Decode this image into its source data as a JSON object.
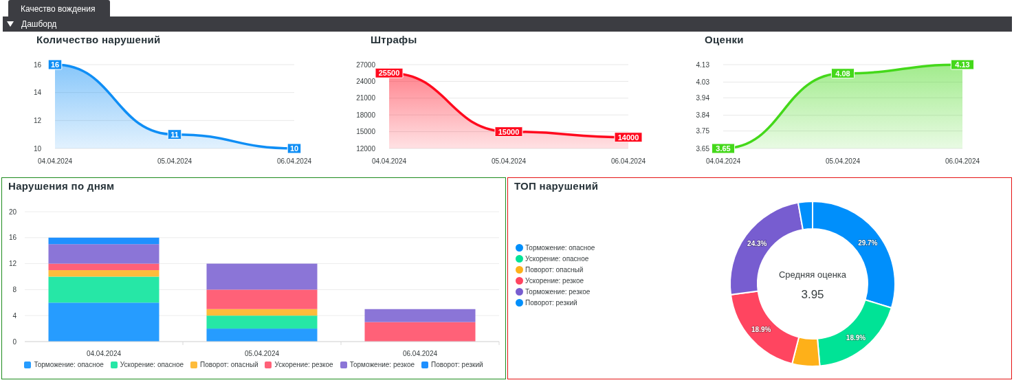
{
  "tabs": [
    {
      "label": "Качество вождения",
      "selected": true
    }
  ],
  "section": {
    "label": "Дашборд",
    "expanded": true
  },
  "line_charts": [
    {
      "title": "Количество нарушений",
      "chart_data": {
        "type": "area",
        "categories": [
          "04.04.2024",
          "05.04.2024",
          "06.04.2024"
        ],
        "ylim": [
          10,
          16
        ],
        "grid": true,
        "yticks": [
          10,
          12,
          14,
          16
        ],
        "data_labels": true,
        "series": [
          {
            "color": "#0f8ef5",
            "values": [
              16,
              11,
              10
            ]
          }
        ]
      }
    },
    {
      "title": "Штрафы",
      "chart_data": {
        "type": "area",
        "categories": [
          "04.04.2024",
          "05.04.2024",
          "06.04.2024"
        ],
        "ylim": [
          12000,
          27000
        ],
        "grid": true,
        "yticks": [
          12000,
          15000,
          18000,
          21000,
          24000,
          27000
        ],
        "data_labels": true,
        "series": [
          {
            "color": "#ff0a1e",
            "values": [
              25500,
              15000,
              14000
            ]
          }
        ]
      }
    },
    {
      "title": "Оценки",
      "chart_data": {
        "type": "area",
        "categories": [
          "04.04.2024",
          "05.04.2024",
          "06.04.2024"
        ],
        "ylim": [
          3.65,
          4.13
        ],
        "grid": true,
        "yticks": [
          3.65,
          3.75,
          3.84,
          3.94,
          4.03,
          4.13
        ],
        "data_labels": true,
        "series": [
          {
            "color": "#44d81a",
            "values": [
              3.65,
              4.08,
              4.13
            ]
          }
        ]
      }
    }
  ],
  "violations_by_day": {
    "title": "Нарушения по дням",
    "chart_data": {
      "type": "bar",
      "stacked": true,
      "categories": [
        "04.04.2024",
        "05.04.2024",
        "06.04.2024"
      ],
      "ylim": [
        0,
        20
      ],
      "grid": true,
      "yticks": [
        0,
        4,
        8,
        12,
        16,
        20
      ],
      "series": [
        {
          "name": "Торможение: опасное",
          "color": "#269cff",
          "values": [
            6,
            2,
            0
          ]
        },
        {
          "name": "Ускорение: опасное",
          "color": "#26e7a6",
          "values": [
            4,
            2,
            0
          ]
        },
        {
          "name": "Поворот: опасный",
          "color": "#febc3b",
          "values": [
            1,
            1,
            0
          ]
        },
        {
          "name": "Ускорение: резкое",
          "color": "#ff6178",
          "values": [
            1,
            3,
            3
          ]
        },
        {
          "name": "Торможение: резкое",
          "color": "#8b75d7",
          "values": [
            3,
            4,
            2
          ]
        },
        {
          "name": "Поворот: резкий",
          "color": "#1e90ff",
          "values": [
            1,
            0,
            0
          ]
        }
      ]
    }
  },
  "top_violations": {
    "title": "ТОП нарушений",
    "center_label": "Средняя оценка",
    "center_value": "3.95",
    "chart_data": {
      "type": "donut",
      "categories": [
        "Торможение: опасное",
        "Ускорение: опасное",
        "Поворот: опасный",
        "Ускорение: резкое",
        "Торможение: резкое",
        "Поворот: резкий"
      ],
      "values": [
        29.7,
        18.9,
        5.4,
        18.9,
        24.3,
        2.8
      ],
      "colors": [
        "#008ffb",
        "#00e396",
        "#feb019",
        "#ff4560",
        "#775dd0",
        "#008ffb"
      ],
      "value_labels": [
        "29.7%",
        "18.9%",
        null,
        "18.9%",
        "24.3%",
        null
      ]
    }
  }
}
